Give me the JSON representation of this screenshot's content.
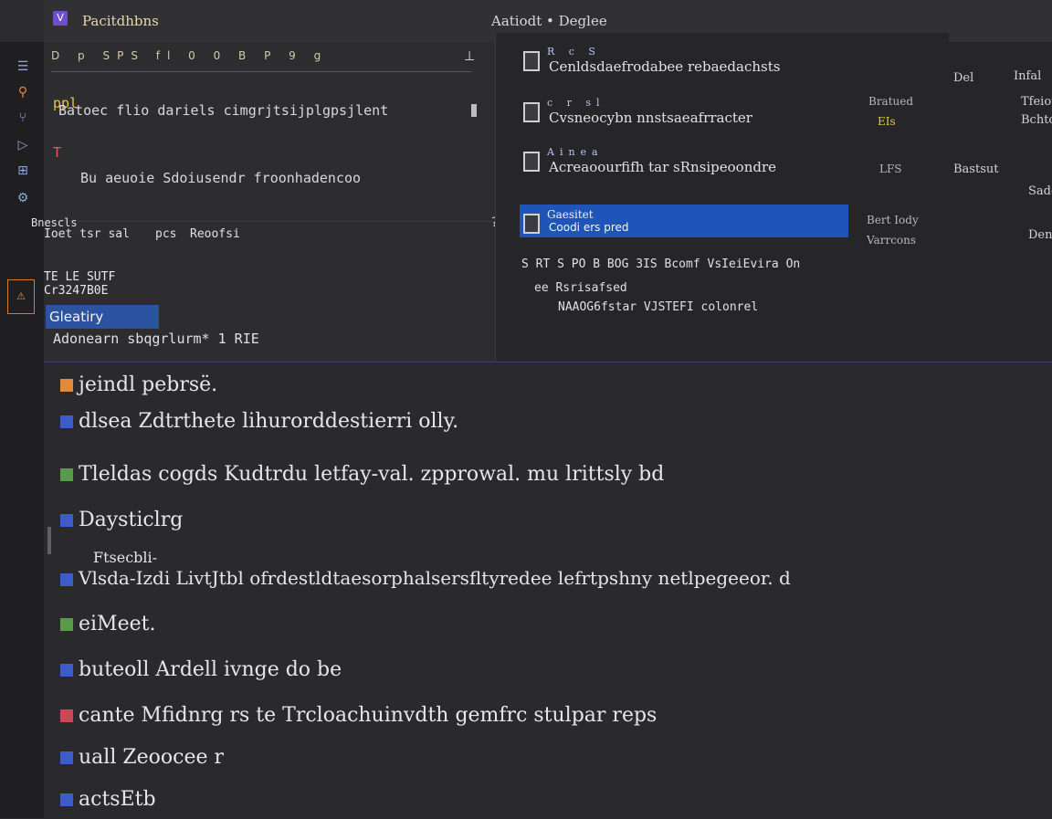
{
  "window": {
    "app_title": "Pacitdhbns",
    "center_title": "Aatiodt • Deglee"
  },
  "activity_icons": [
    "explorer-icon",
    "search-icon",
    "source-control-icon",
    "debug-icon",
    "extensions-icon",
    "settings-icon"
  ],
  "editor": {
    "ruler": "D p SPS fl 0 0 B P 9 g",
    "lines": [
      "Batoec flio dariels cimgrjtsijplgpsjlent",
      "Bu aeuoie Sdoiusendr froonhadencoo"
    ],
    "line_prefix": [
      "ppl",
      "T"
    ],
    "breadcrumb": [
      "Ioet tsr sal",
      "pcs",
      "Reoofsi"
    ],
    "breadcrumb_head": "Bnescls",
    "status_lines": [
      "TE LE SUTF",
      "Cr3247B0E"
    ],
    "selected_chip": "Gleatiry",
    "hint": "Adonearn sbqgrlurm* 1 RIE"
  },
  "explorer": {
    "items": [
      {
        "small": "R c S",
        "main": "Cenldsdaefrodabee rebaedachsts"
      },
      {
        "small": "c r sl",
        "main": "Cvsneocybn nnstsaeafrracter"
      },
      {
        "small": "Ainea",
        "main": "Acreaoourfifh  tar sRnsipeoondre"
      },
      {
        "small": "Gaesitet",
        "main": "Coodi ers pred"
      }
    ],
    "right_labels": [
      "Bratued",
      "EIs",
      "LFS",
      "Bert Iody",
      "Varrcons"
    ],
    "toolbar": "S RT S  PO B BOG  3IS Bcomf  VsIeiEvira On",
    "tree": [
      "ee Rsrisafsed",
      "NAAOG6fstar VJSTEFI colonrel"
    ]
  },
  "far_panel": {
    "labels": [
      "Del",
      "Infal",
      "Bastsut",
      "Tfeiot",
      "Bchtot",
      "Sadc",
      "Dent"
    ]
  },
  "terminal": {
    "lines": [
      "jeindl pebrsë.",
      "dlsea Zdtrthete lihurorddestierri olly.",
      "Tleldas cogds Kudtrdu letfay-val. zpprowal. mu lrittsly bd",
      "Daysticlrg",
      "Vlsda-Izdi LivtJtbl ofrdestldtaesorphalsersfltyredee lefrtpshny netlpegeeor. d",
      "eiMeet.",
      "buteoll Ardell ivnge do be",
      "cante Mfidnrg rs te   Trcloachuinvdth gemfrc  stulpar reps",
      "uall Zeoocee  r",
      "actsEtb"
    ],
    "sub_label": "Ftsecbli-"
  }
}
